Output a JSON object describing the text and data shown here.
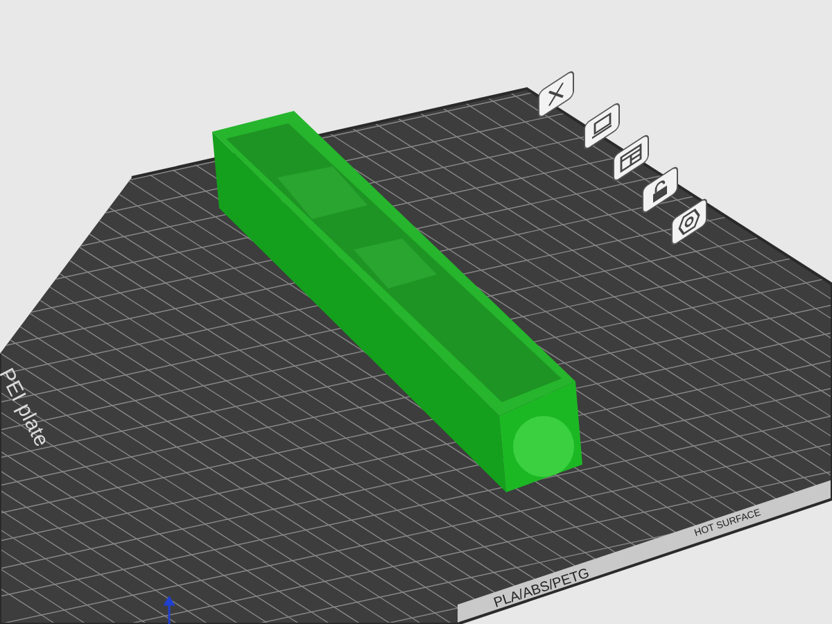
{
  "plate": {
    "name_label": "PEI plate",
    "filament_label": "PLA/ABS/PETG",
    "warning_label": "HOT SURFACE"
  },
  "toolbar": [
    {
      "kind": "close"
    },
    {
      "kind": "monitor"
    },
    {
      "kind": "layout"
    },
    {
      "kind": "lock"
    },
    {
      "kind": "hexagon"
    }
  ]
}
